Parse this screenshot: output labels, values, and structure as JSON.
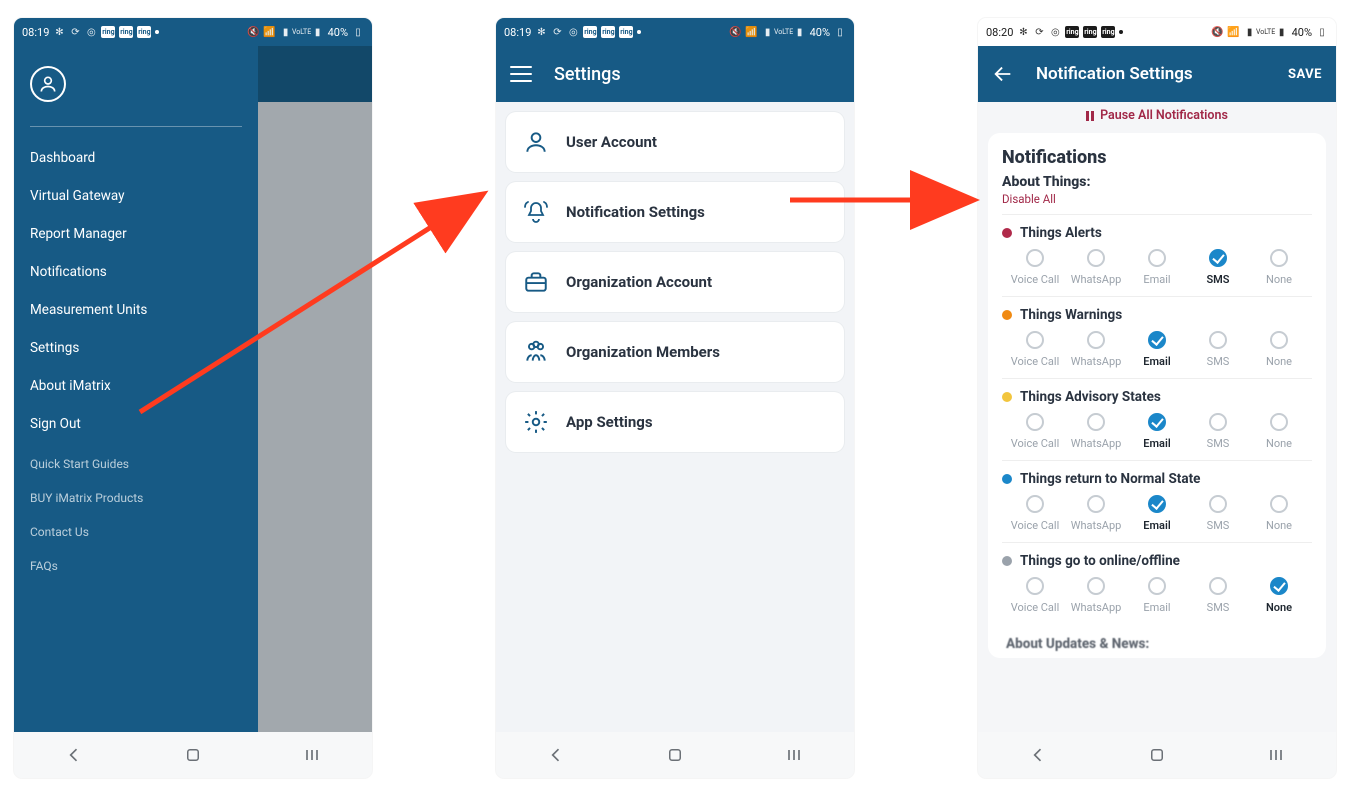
{
  "status": {
    "time_left_center": "08:19",
    "time_right": "08:20",
    "battery_text": "40%",
    "net_label": "VoLTE",
    "sb_box_text": "ring"
  },
  "left_phone": {
    "drawer": {
      "primary": [
        "Dashboard",
        "Virtual Gateway",
        "Report Manager",
        "Notifications",
        "Measurement Units",
        "Settings",
        "About iMatrix",
        "Sign Out"
      ],
      "secondary": [
        "Quick Start Guides",
        "BUY iMatrix Products",
        "Contact Us",
        "FAQs"
      ]
    }
  },
  "center_phone": {
    "header_title": "Settings",
    "items": [
      {
        "icon": "user",
        "label": "User Account"
      },
      {
        "icon": "bell",
        "label": "Notification Settings"
      },
      {
        "icon": "case",
        "label": "Organization Account"
      },
      {
        "icon": "people",
        "label": "Organization Members"
      },
      {
        "icon": "gear",
        "label": "App Settings"
      }
    ]
  },
  "right_phone": {
    "header_title": "Notification Settings",
    "save_label": "SAVE",
    "pause_label": "Pause All Notifications",
    "section_title": "Notifications",
    "subsection_title": "About Things:",
    "disable_all_label": "Disable All",
    "option_labels": [
      "Voice Call",
      "WhatsApp",
      "Email",
      "SMS",
      "None"
    ],
    "categories": [
      {
        "name": "Things Alerts",
        "color": "#b02a4a",
        "selected": "SMS"
      },
      {
        "name": "Things Warnings",
        "color": "#f08a12",
        "selected": "Email"
      },
      {
        "name": "Things Advisory States",
        "color": "#f2c53d",
        "selected": "Email"
      },
      {
        "name": "Things return to Normal State",
        "color": "#1b87c9",
        "selected": "Email"
      },
      {
        "name": "Things go to online/offline",
        "color": "#9aa2ab",
        "selected": "None"
      }
    ],
    "next_section_title": "About Updates & News:"
  }
}
